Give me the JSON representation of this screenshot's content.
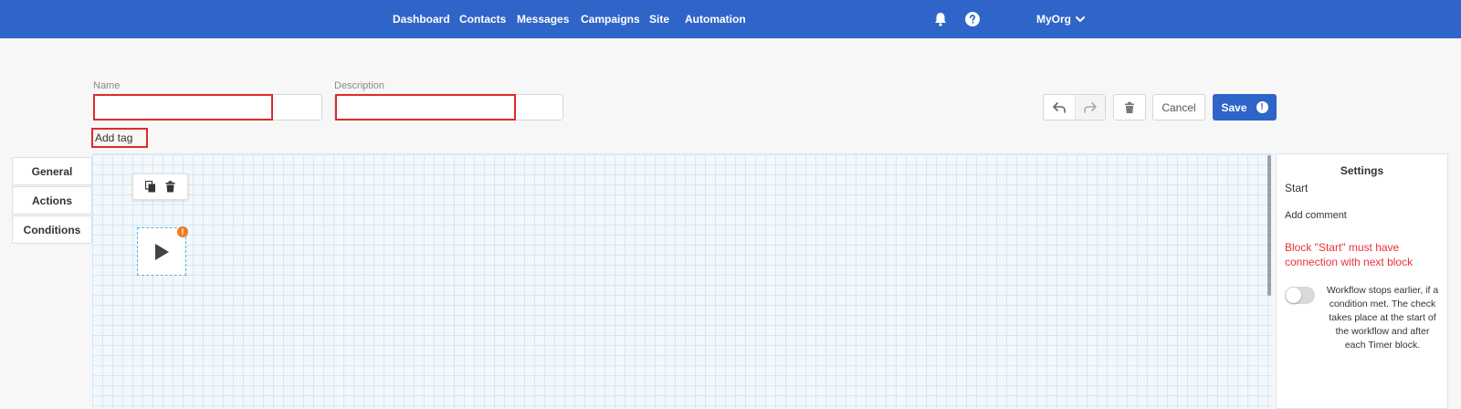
{
  "nav": {
    "links": [
      "Dashboard",
      "Contacts",
      "Messages",
      "Campaigns",
      "Site",
      "Automation"
    ],
    "org": "MyOrg",
    "icons": [
      "bell-icon",
      "help-icon",
      "chevron-down-icon"
    ]
  },
  "form": {
    "name_label": "Name",
    "name_value": "",
    "description_label": "Description",
    "description_value": "",
    "add_tag": "Add tag"
  },
  "toolbar": {
    "undo_icon": "undo-icon",
    "redo_icon": "redo-icon",
    "trash_icon": "trash-icon",
    "cancel_label": "Cancel",
    "save_label": "Save",
    "save_status_glyph": "!"
  },
  "side_tabs": [
    "General",
    "Actions",
    "Conditions"
  ],
  "canvas": {
    "block_toolbar_icons": [
      "copy-icon",
      "trash-icon"
    ],
    "start_block_icon": "play-icon",
    "start_badge_glyph": "!"
  },
  "settings": {
    "title": "Settings",
    "block_name": "Start",
    "add_comment": "Add comment",
    "error_text": "Block \"Start\" must have connection with next block",
    "toggle_on": false,
    "toggle_text": "Workflow stops earlier, if a condition met. The check takes place at the start of the workflow and after each Timer block."
  },
  "colors": {
    "brand": "#2f64c9",
    "error": "#e8333a",
    "badge": "#f07b22",
    "highlight": "#e02a2a"
  }
}
